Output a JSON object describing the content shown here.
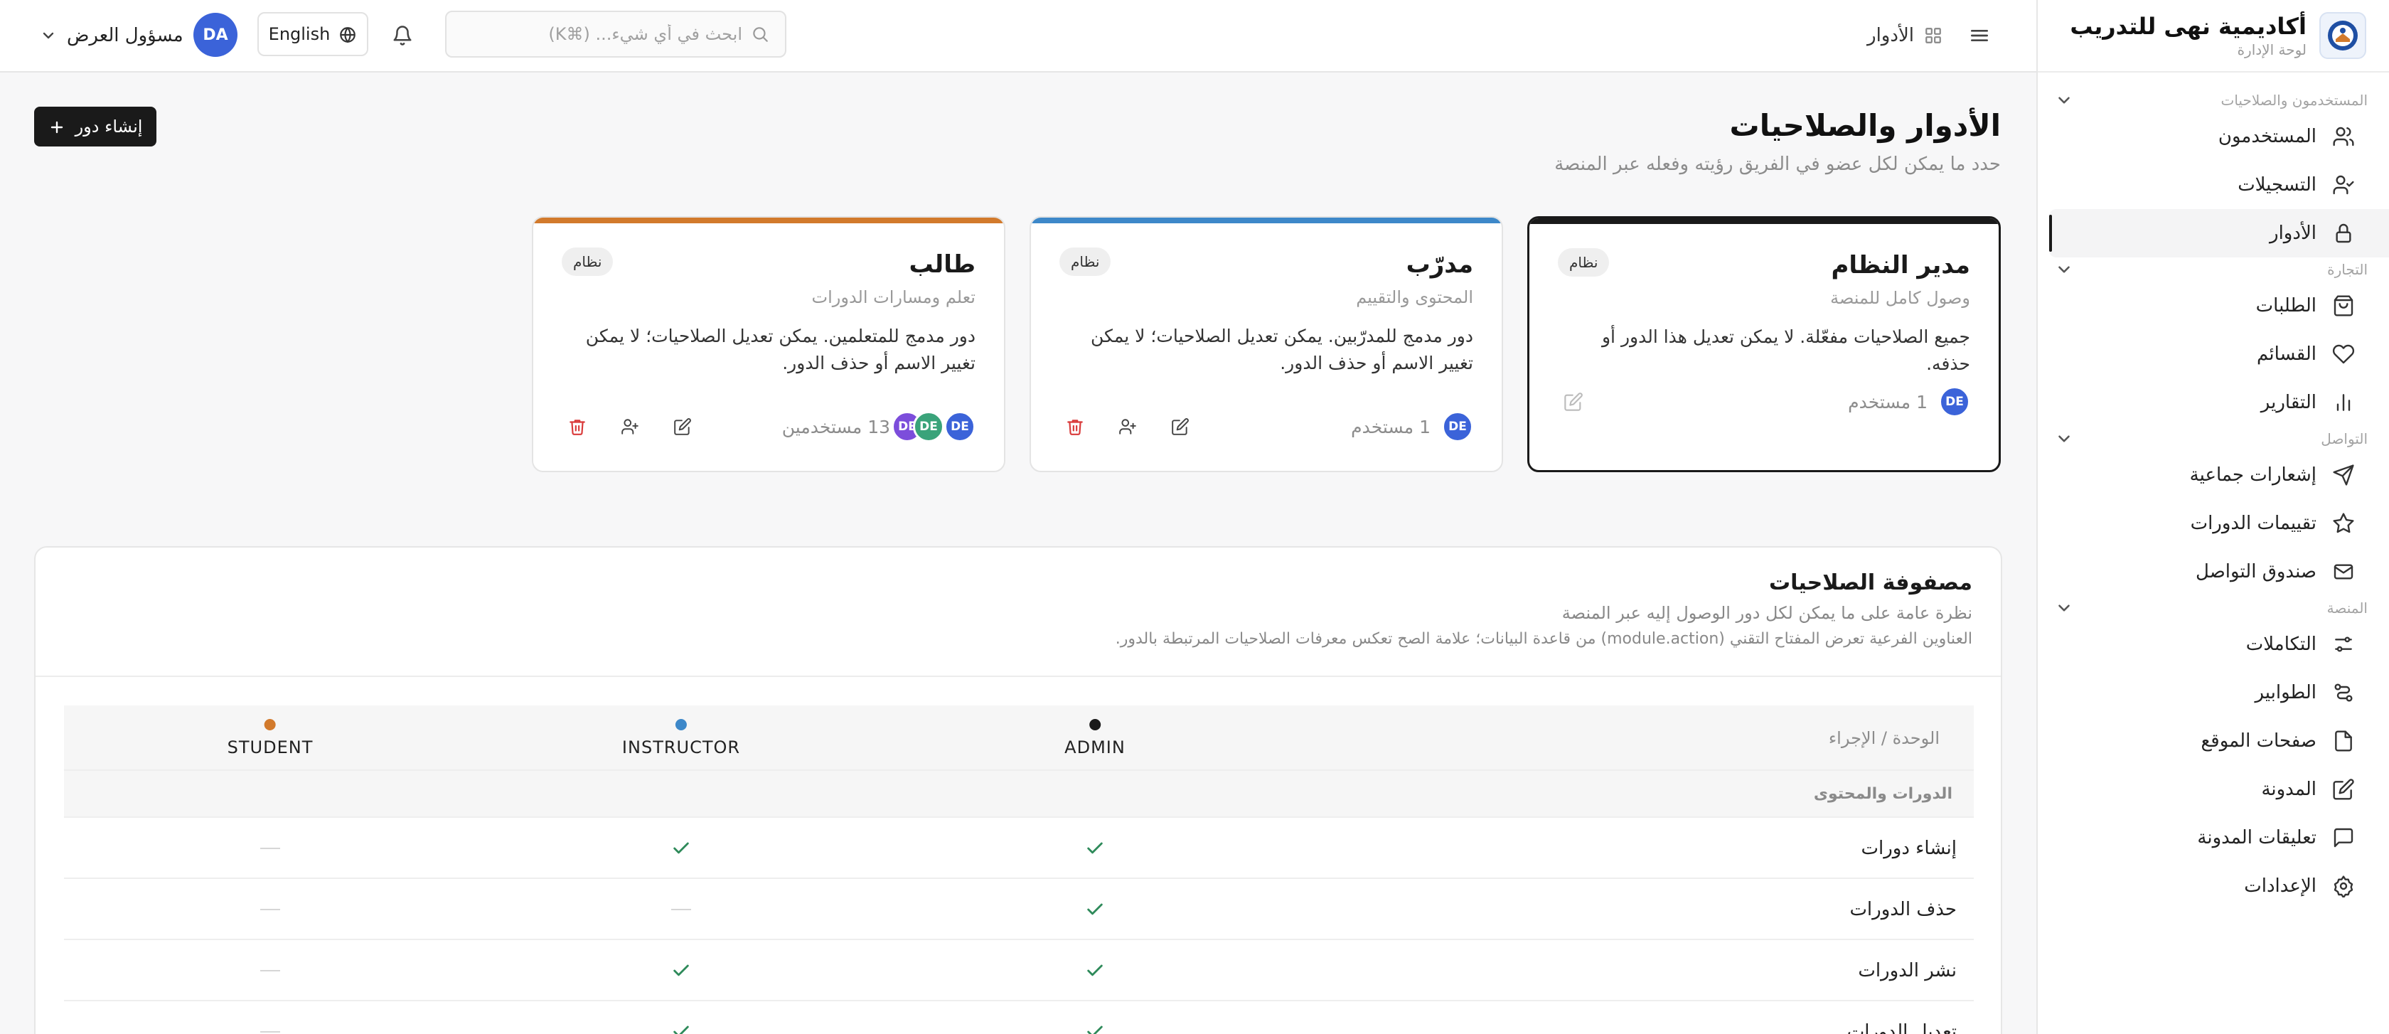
{
  "app": {
    "name": "أكاديمية نهى للتدريب",
    "subtitle": "لوحة الإدارة"
  },
  "sidebar": {
    "sections": [
      {
        "label": "المستخدمون والصلاحيات",
        "items": [
          {
            "label": "المستخدمون",
            "icon": "users-icon",
            "active": false
          },
          {
            "label": "التسجيلات",
            "icon": "user-check-icon",
            "active": false
          },
          {
            "label": "الأدوار",
            "icon": "lock-icon",
            "active": true
          }
        ]
      },
      {
        "label": "التجارة",
        "items": [
          {
            "label": "الطلبات",
            "icon": "shopping-bag-icon",
            "active": false
          },
          {
            "label": "القسائم",
            "icon": "heart-icon",
            "active": false
          },
          {
            "label": "التقارير",
            "icon": "bar-chart-icon",
            "active": false
          }
        ]
      },
      {
        "label": "التواصل",
        "items": [
          {
            "label": "إشعارات جماعية",
            "icon": "send-icon",
            "active": false
          },
          {
            "label": "تقييمات الدورات",
            "icon": "star-icon",
            "active": false
          },
          {
            "label": "صندوق التواصل",
            "icon": "mail-icon",
            "active": false
          }
        ]
      },
      {
        "label": "المنصة",
        "items": [
          {
            "label": "التكاملات",
            "icon": "sliders-icon",
            "active": false
          },
          {
            "label": "الطوابير",
            "icon": "workflow-icon",
            "active": false
          },
          {
            "label": "صفحات الموقع",
            "icon": "file-icon",
            "active": false
          },
          {
            "label": "المدونة",
            "icon": "edit-icon",
            "active": false
          },
          {
            "label": "تعليقات المدونة",
            "icon": "message-icon",
            "active": false
          },
          {
            "label": "الإعدادات",
            "icon": "settings-icon",
            "active": false
          }
        ]
      }
    ]
  },
  "header": {
    "breadcrumb": "الأدوار",
    "search_placeholder": "ابحث في أي شيء... (⌘K)",
    "language": "English",
    "user_initials": "DA",
    "user_name": "مسؤول العرض"
  },
  "page": {
    "title": "الأدوار والصلاحيات",
    "subtitle": "حدد ما يمكن لكل عضو في الفريق رؤيته وفعله عبر المنصة",
    "create_button": "إنشاء دور"
  },
  "roles": [
    {
      "name": "مدير النظام",
      "subtitle": "وصول كامل للمنصة",
      "description": "جميع الصلاحيات مفعّلة. لا يمكن تعديل هذا الدور أو حذفه.",
      "badge": "نظام",
      "users_label": "1 مستخدم",
      "avatars": [
        {
          "initials": "DE",
          "color": "#3b63d9"
        }
      ],
      "accent": "#1a1a1a",
      "selected": true
    },
    {
      "name": "مدرّب",
      "subtitle": "المحتوى والتقييم",
      "description": "دور مدمج للمدرّبين. يمكن تعديل الصلاحيات؛ لا يمكن تغيير الاسم أو حذف الدور.",
      "badge": "نظام",
      "users_label": "1 مستخدم",
      "avatars": [
        {
          "initials": "DE",
          "color": "#3b63d9"
        }
      ],
      "accent": "#3d88c9",
      "selected": false
    },
    {
      "name": "طالب",
      "subtitle": "تعلم ومسارات الدورات",
      "description": "دور مدمج للمتعلمين. يمكن تعديل الصلاحيات؛ لا يمكن تغيير الاسم أو حذف الدور.",
      "badge": "نظام",
      "users_label": "13 مستخدمين",
      "avatars": [
        {
          "initials": "DE",
          "color": "#3b63d9"
        },
        {
          "initials": "DE",
          "color": "#3aa37a"
        },
        {
          "initials": "DE",
          "color": "#7c4ddb"
        }
      ],
      "accent": "#d27a2c",
      "selected": false
    }
  ],
  "matrix": {
    "title": "مصفوفة الصلاحيات",
    "subtitle": "نظرة عامة على ما يمكن لكل دور الوصول إليه عبر المنصة",
    "note": "العناوين الفرعية تعرض المفتاح التقني (module.action) من قاعدة البيانات؛ علامة الصح تعكس معرفات الصلاحيات المرتبطة بالدور.",
    "module_header": "الوحدة / الإجراء",
    "columns": [
      {
        "label": "ADMIN",
        "color": "#1a1a1a"
      },
      {
        "label": "INSTRUCTOR",
        "color": "#3d88c9"
      },
      {
        "label": "STUDENT",
        "color": "#d27a2c"
      }
    ],
    "group": "الدورات والمحتوى",
    "rows": [
      {
        "label": "إنشاء دورات",
        "values": [
          true,
          true,
          false
        ]
      },
      {
        "label": "حذف الدورات",
        "values": [
          true,
          false,
          false
        ]
      },
      {
        "label": "نشر الدورات",
        "values": [
          true,
          true,
          false
        ]
      },
      {
        "label": "تعديل الدورات",
        "values": [
          true,
          true,
          false
        ]
      }
    ]
  },
  "colors": {
    "check": "#2e8a5a",
    "delete": "#d93a3a"
  }
}
